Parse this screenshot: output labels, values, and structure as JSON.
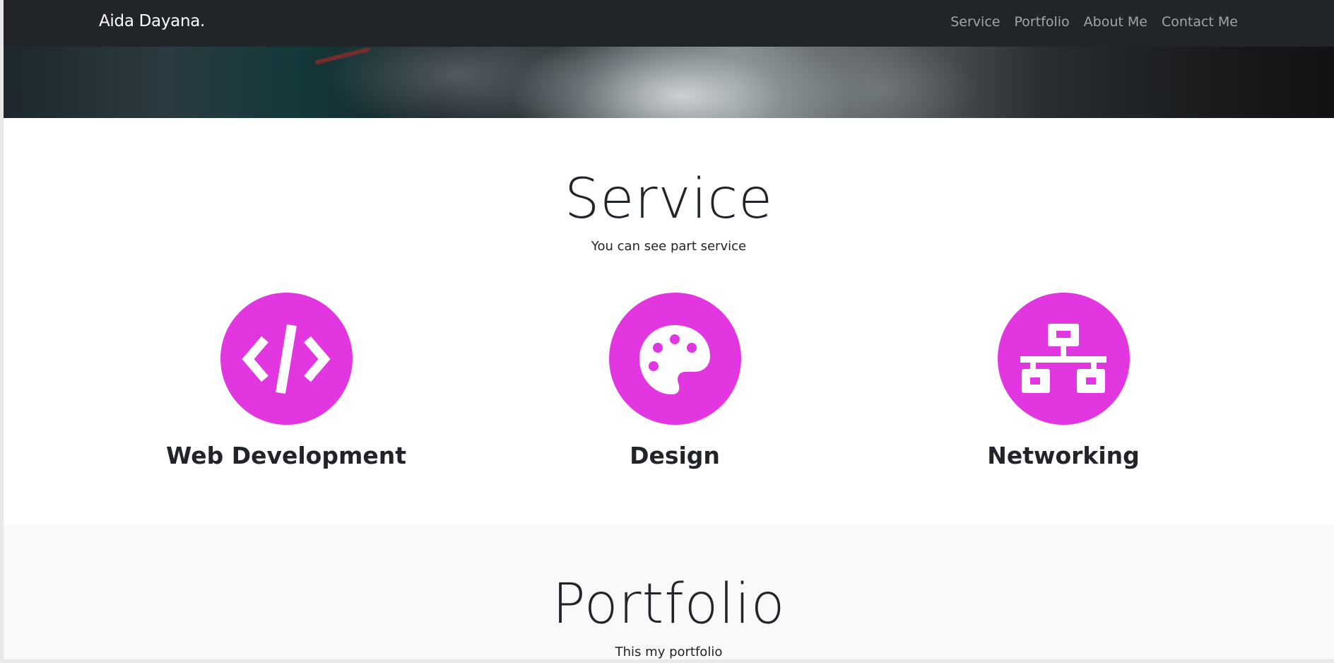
{
  "navbar": {
    "brand": "Aida Dayana.",
    "links": [
      "Service",
      "Portfolio",
      "About Me",
      "Contact Me"
    ]
  },
  "service": {
    "title": "Service",
    "subtitle": "You can see part service",
    "items": [
      {
        "name": "Web Development",
        "icon": "code-icon"
      },
      {
        "name": "Design",
        "icon": "palette-icon"
      },
      {
        "name": "Networking",
        "icon": "network-icon"
      }
    ]
  },
  "portfolio": {
    "title": "Portfolio",
    "subtitle": "This my portfolio"
  },
  "colors": {
    "navbar_bg": "#212529",
    "accent": "#e236e0",
    "section_alt_bg": "#f8f9fa"
  }
}
